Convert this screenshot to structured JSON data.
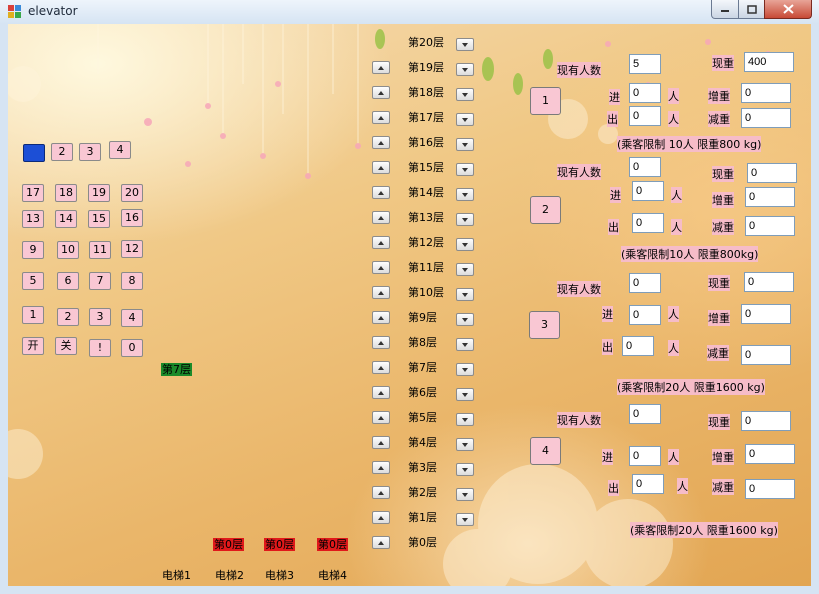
{
  "window": {
    "title": "elevator"
  },
  "icons": {
    "app": "app-icon",
    "minimize": "minimize-icon",
    "maximize": "maximize-icon",
    "close": "close-icon",
    "up": "up-arrow-icon",
    "down": "down-arrow-icon"
  },
  "colors": {
    "selected_key": "#1c4fd6",
    "key_bg": "#f9c7d3",
    "floor_status_red": "#e0181a",
    "floor_status_green": "#1a8a2a"
  },
  "keypad": {
    "rows": [
      [
        " ",
        "2",
        "3",
        "4"
      ],
      [
        "17",
        "18",
        "19",
        "20"
      ],
      [
        "13",
        "14",
        "15",
        "16"
      ],
      [
        "9",
        "10",
        "11",
        "12"
      ],
      [
        "5",
        "6",
        "7",
        "8"
      ],
      [
        "1",
        "2",
        "3",
        "4"
      ],
      [
        "开",
        "关",
        "!",
        "0"
      ]
    ],
    "current_floor": "第7层"
  },
  "floors": [
    "第20层",
    "第19层",
    "第18层",
    "第17层",
    "第16层",
    "第15层",
    "第14层",
    "第13层",
    "第12层",
    "第11层",
    "第10层",
    "第9层",
    "第8层",
    "第7层",
    "第6层",
    "第5层",
    "第4层",
    "第3层",
    "第2层",
    "第1层",
    "第0层"
  ],
  "elevators_bottom": {
    "status": [
      "第0层",
      "第0层",
      "第0层"
    ],
    "labels": [
      "电梯1",
      "电梯2",
      "电梯3",
      "电梯4"
    ]
  },
  "panels": [
    {
      "button": "1",
      "count_label": "现有人数",
      "count": "5",
      "weight_label": "现重",
      "weight": "400",
      "in_label": "进",
      "in": "0",
      "out_label": "出",
      "out": "0",
      "person": "人",
      "add_label": "增重",
      "add": "0",
      "sub_label": "减重",
      "sub": "0",
      "limit": "(乘客限制 10人 限重800 kg)"
    },
    {
      "button": "2",
      "count_label": "现有人数",
      "count": "0",
      "weight_label": "现重",
      "weight": "0",
      "in_label": "进",
      "in": "0",
      "out_label": "出",
      "out": "0",
      "person": "人",
      "add_label": "增重",
      "add": "0",
      "sub_label": "减重",
      "sub": "0",
      "limit": "(乘客限制10人 限重800kg)"
    },
    {
      "button": "3",
      "count_label": "现有人数",
      "count": "0",
      "weight_label": "现重",
      "weight": "0",
      "in_label": "进",
      "in": "0",
      "out_label": "出",
      "out": "0",
      "person": "人",
      "add_label": "增重",
      "add": "0",
      "sub_label": "减重",
      "sub": "0",
      "limit": "(乘客限制20人 限重1600 kg)"
    },
    {
      "button": "4",
      "count_label": "现有人数",
      "count": "0",
      "weight_label": "现重",
      "weight": "0",
      "in_label": "进",
      "in": "0",
      "out_label": "出",
      "out": "0",
      "person": "人",
      "add_label": "增重",
      "add": "0",
      "sub_label": "减重",
      "sub": "0",
      "limit": "(乘客限制20人 限重1600 kg)"
    }
  ]
}
